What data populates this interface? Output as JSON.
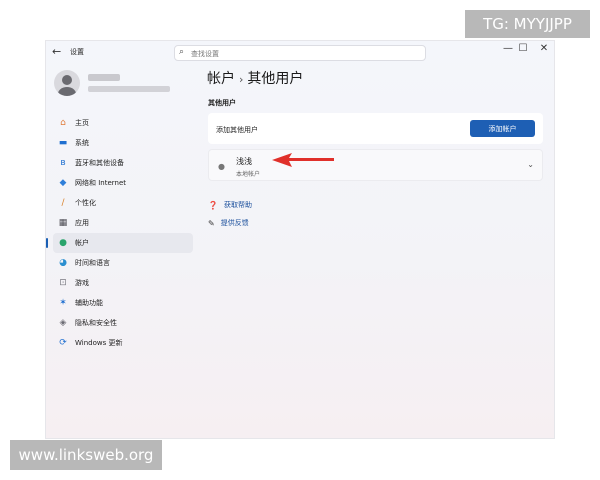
{
  "window": {
    "app_title": "设置",
    "back": "←",
    "controls": {
      "minimize": "—",
      "maximize": "☐",
      "close": "✕"
    }
  },
  "search": {
    "placeholder": "查找设置"
  },
  "sidebar": {
    "items": [
      {
        "label": "主页",
        "icon": "home-icon",
        "glyph": "⌂",
        "color": "#e07b39"
      },
      {
        "label": "系统",
        "icon": "monitor-icon",
        "glyph": "▬",
        "color": "#1f6fd0"
      },
      {
        "label": "蓝牙和其他设备",
        "icon": "bluetooth-icon",
        "glyph": "ʙ",
        "color": "#1f6fd0"
      },
      {
        "label": "网络和 Internet",
        "icon": "wifi-icon",
        "glyph": "◆",
        "color": "#2f7fd9"
      },
      {
        "label": "个性化",
        "icon": "brush-icon",
        "glyph": "∕",
        "color": "#d9822b"
      },
      {
        "label": "应用",
        "icon": "apps-icon",
        "glyph": "▦",
        "color": "#4a4a52"
      },
      {
        "label": "帐户",
        "icon": "account-icon",
        "glyph": "●",
        "color": "#2aa46c",
        "active": true
      },
      {
        "label": "时间和语言",
        "icon": "globe-icon",
        "glyph": "◕",
        "color": "#2b8fd0"
      },
      {
        "label": "游戏",
        "icon": "gamepad-icon",
        "glyph": "⊡",
        "color": "#7a7a82"
      },
      {
        "label": "辅助功能",
        "icon": "accessibility-icon",
        "glyph": "✶",
        "color": "#1f6fd0"
      },
      {
        "label": "隐私和安全性",
        "icon": "shield-icon",
        "glyph": "◈",
        "color": "#6b6b73"
      },
      {
        "label": "Windows 更新",
        "icon": "update-icon",
        "glyph": "⟳",
        "color": "#1f6fd0"
      }
    ]
  },
  "breadcrumb": {
    "parent": "帐户",
    "separator": "›",
    "current": "其他用户"
  },
  "other_users": {
    "section_title": "其他用户",
    "add_label": "添加其他用户",
    "add_button": "添加帐户",
    "user": {
      "name": "浅浅",
      "type": "本地帐户"
    }
  },
  "links": {
    "help": "获取帮助",
    "feedback": "提供反馈"
  },
  "overlays": {
    "tg": "TG: MYYJJPP",
    "site": "www.linksweb.org"
  },
  "colors": {
    "accent": "#1e5fb4",
    "arrow": "#e0302a"
  }
}
